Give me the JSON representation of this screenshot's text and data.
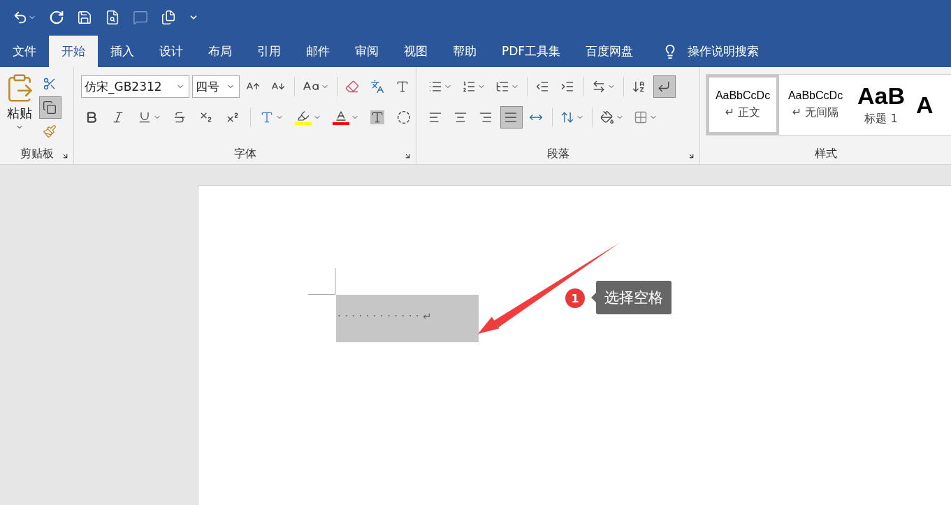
{
  "tabs": [
    {
      "label": "文件",
      "selected": false
    },
    {
      "label": "开始",
      "selected": true
    },
    {
      "label": "插入",
      "selected": false
    },
    {
      "label": "设计",
      "selected": false
    },
    {
      "label": "布局",
      "selected": false
    },
    {
      "label": "引用",
      "selected": false
    },
    {
      "label": "邮件",
      "selected": false
    },
    {
      "label": "审阅",
      "selected": false
    },
    {
      "label": "视图",
      "selected": false
    },
    {
      "label": "帮助",
      "selected": false
    },
    {
      "label": "PDF工具集",
      "selected": false
    },
    {
      "label": "百度网盘",
      "selected": false
    }
  ],
  "tell_me": {
    "label": "操作说明搜索"
  },
  "clipboard": {
    "paste_label": "粘贴",
    "group_label": "剪贴板",
    "copy": {
      "selected": true
    }
  },
  "font": {
    "name": "仿宋_GB2312",
    "size": "四号",
    "group_label": "字体"
  },
  "paragraph": {
    "group_label": "段落",
    "alignment": [
      {
        "kind": "left",
        "selected": false
      },
      {
        "kind": "center",
        "selected": false
      },
      {
        "kind": "right",
        "selected": false
      },
      {
        "kind": "justify",
        "selected": true
      },
      {
        "kind": "distributed",
        "selected": false
      }
    ],
    "show_marks": {
      "selected": true
    }
  },
  "styles": {
    "group_label": "样式",
    "items": [
      {
        "kind": "body",
        "preview": "AaBbCcDc",
        "label": "↵ 正文",
        "selected": true
      },
      {
        "kind": "body",
        "preview": "AaBbCcDc",
        "label": "↵ 无间隔",
        "selected": false
      },
      {
        "kind": "heading",
        "preview": "AaB",
        "label": "标题 1",
        "selected": false
      },
      {
        "kind": "heading",
        "preview": "A",
        "selected": false
      }
    ]
  },
  "document": {
    "selection_marks": "············↵"
  },
  "annotation": {
    "step": "1",
    "label": "选择空格"
  }
}
